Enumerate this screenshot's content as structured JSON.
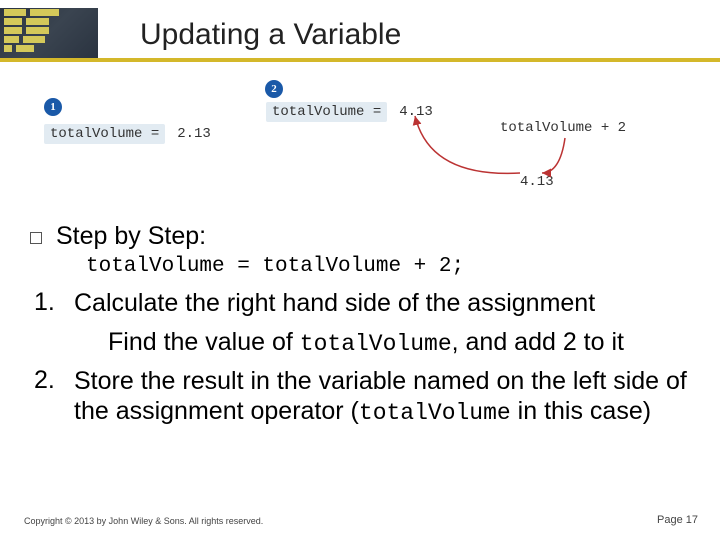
{
  "header": {
    "title": "Updating a Variable"
  },
  "diagram": {
    "badge1": "1",
    "badge2": "2",
    "eq1_lhs_expr": "totalVolume =",
    "eq1_lhs_val": "2.13",
    "eq2_lhs_expr": "totalVolume =",
    "eq2_lhs_val": "4.13",
    "rhs_expr": "totalVolume + 2",
    "rhs_val": "4.13"
  },
  "content": {
    "step_by_step_label": "Step by Step:",
    "code_line": "totalVolume = totalVolume + 2;",
    "item1_num": "1.",
    "item1_text_a": "Calculate the right hand side of the assignment",
    "item1_text_b_pre": "Find the value of ",
    "item1_text_b_code": "totalVolume",
    "item1_text_b_post": ", and add 2 to it",
    "item2_num": "2.",
    "item2_text_pre": "Store the result in the variable named on the left side of the assignment operator (",
    "item2_text_code": "totalVolume",
    "item2_text_post": " in this case)"
  },
  "footer": {
    "copyright": "Copyright © 2013 by John Wiley & Sons. All rights reserved.",
    "page": "Page 17"
  }
}
